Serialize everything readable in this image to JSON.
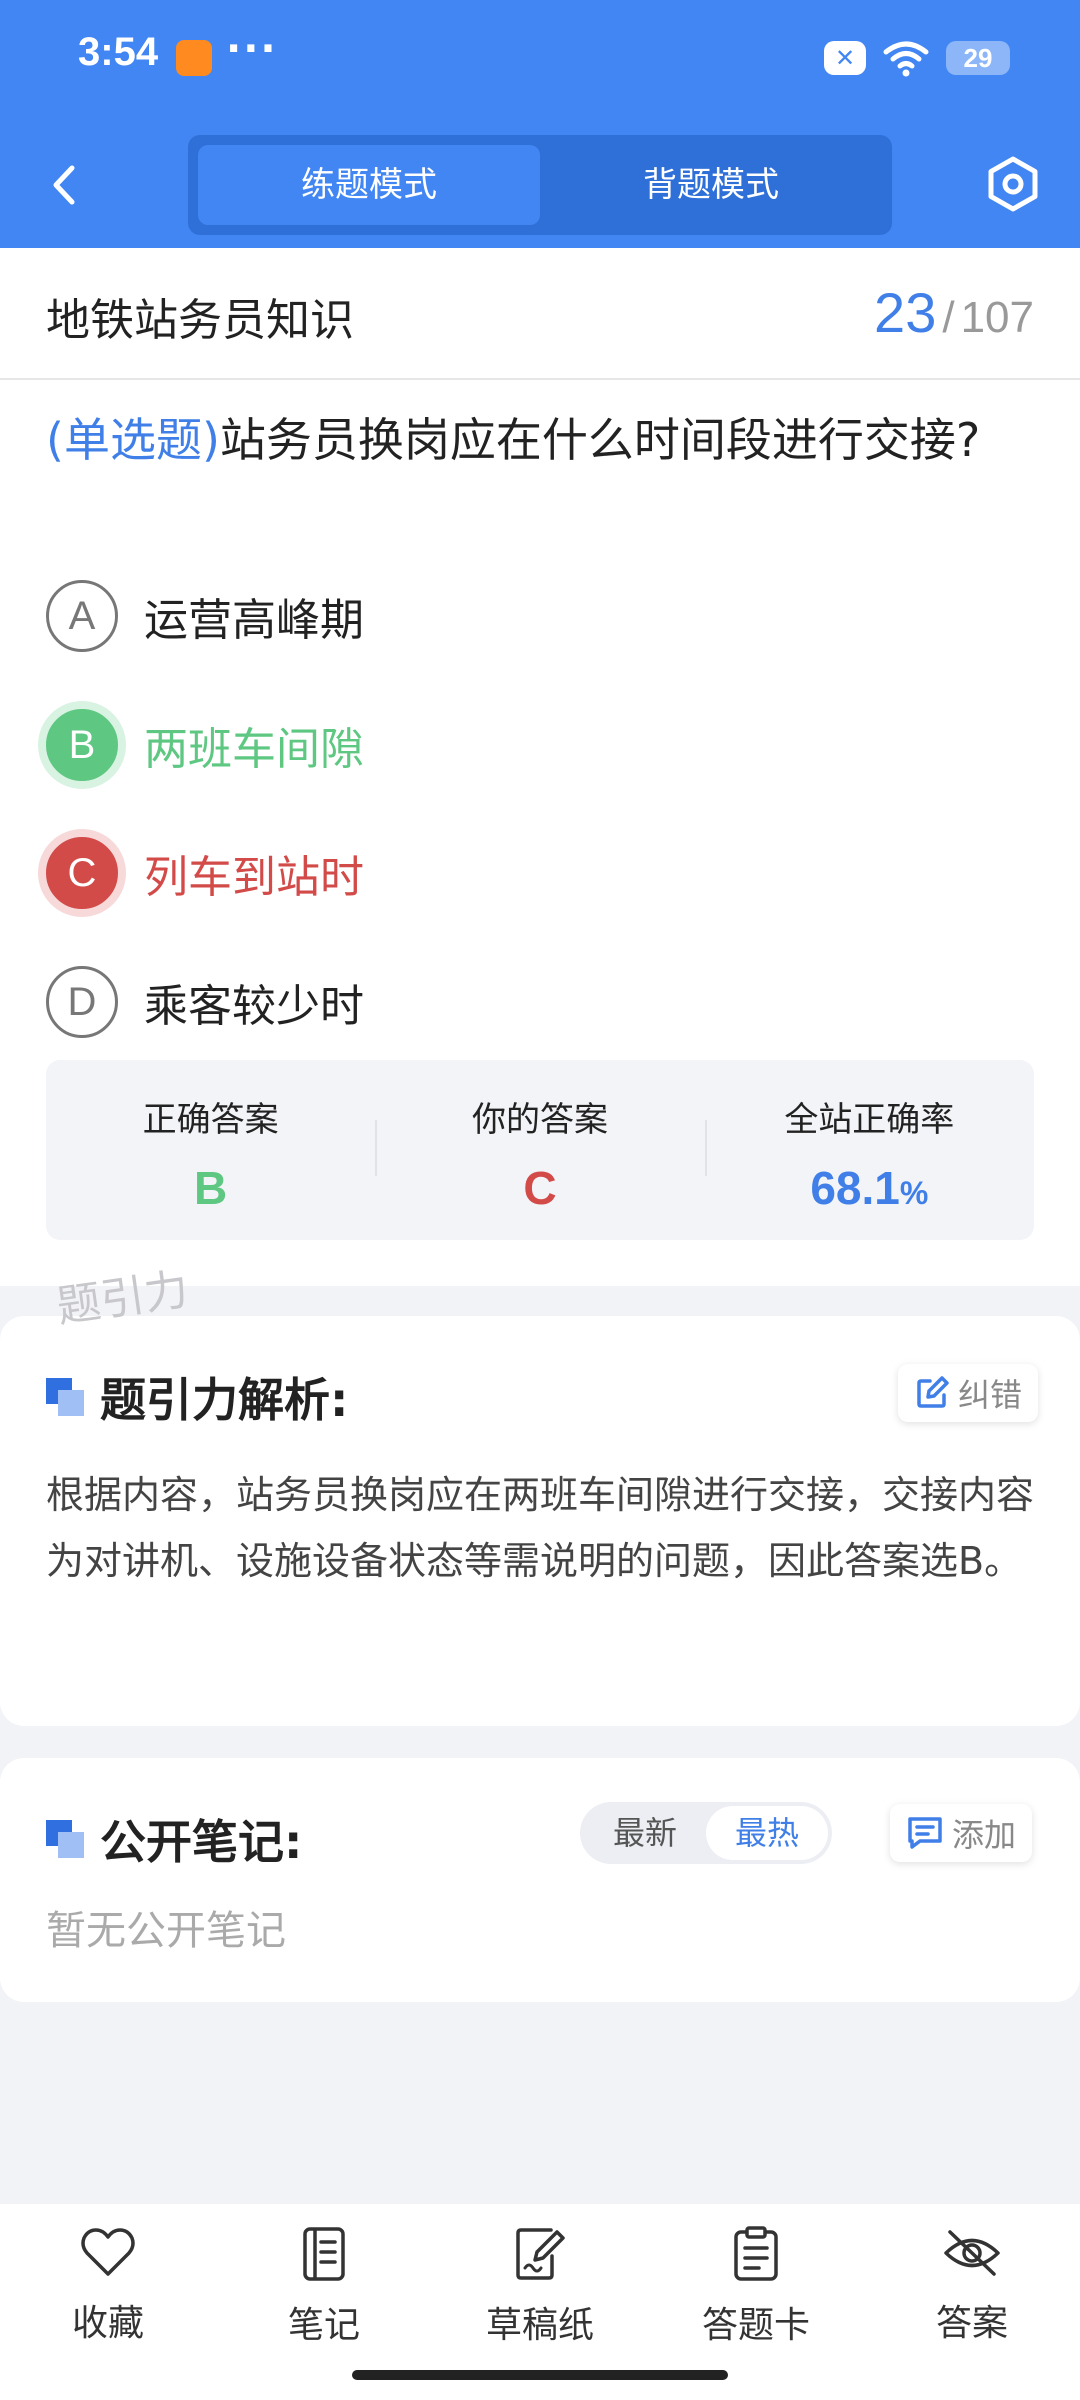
{
  "status_bar": {
    "time": "3:54",
    "more": "···",
    "battery": "29"
  },
  "header": {
    "tabs": [
      "练题模式",
      "背题模式"
    ],
    "active_tab": 0
  },
  "topic": {
    "title": "地铁站务员知识",
    "current": "23",
    "separator": "/",
    "total": "107"
  },
  "question": {
    "type": "(单选题)",
    "text": "站务员换岗应在什么时间段进行交接?",
    "options": [
      {
        "letter": "A",
        "text": "运营高峰期",
        "state": "normal"
      },
      {
        "letter": "B",
        "text": "两班车间隙",
        "state": "correct"
      },
      {
        "letter": "C",
        "text": "列车到站时",
        "state": "wrong"
      },
      {
        "letter": "D",
        "text": "乘客较少时",
        "state": "normal"
      }
    ]
  },
  "result": {
    "correct_label": "正确答案",
    "correct_value": "B",
    "yours_label": "你的答案",
    "yours_value": "C",
    "rate_label": "全站正确率",
    "rate_value": "68.1",
    "rate_unit": "%"
  },
  "watermark": "题引力",
  "analysis": {
    "title": "题引力解析:",
    "report_label": "纠错",
    "text": "根据内容，站务员换岗应在两班车间隙进行交接，交接内容为对讲机、设施设备状态等需说明的问题，因此答案选B。"
  },
  "notes": {
    "title": "公开笔记:",
    "sort_options": [
      "最新",
      "最热"
    ],
    "active_sort": 1,
    "add_label": "添加",
    "empty_text": "暂无公开笔记"
  },
  "bottom_nav": [
    {
      "label": "收藏",
      "icon": "heart-icon"
    },
    {
      "label": "笔记",
      "icon": "notebook-icon"
    },
    {
      "label": "草稿纸",
      "icon": "draft-paper-icon"
    },
    {
      "label": "答题卡",
      "icon": "answer-sheet-icon"
    },
    {
      "label": "答案",
      "icon": "eye-off-icon"
    }
  ],
  "colors": {
    "primary": "#4186f3",
    "correct": "#5ec781",
    "wrong": "#d24b49",
    "accent_text": "#3f7fe7"
  }
}
